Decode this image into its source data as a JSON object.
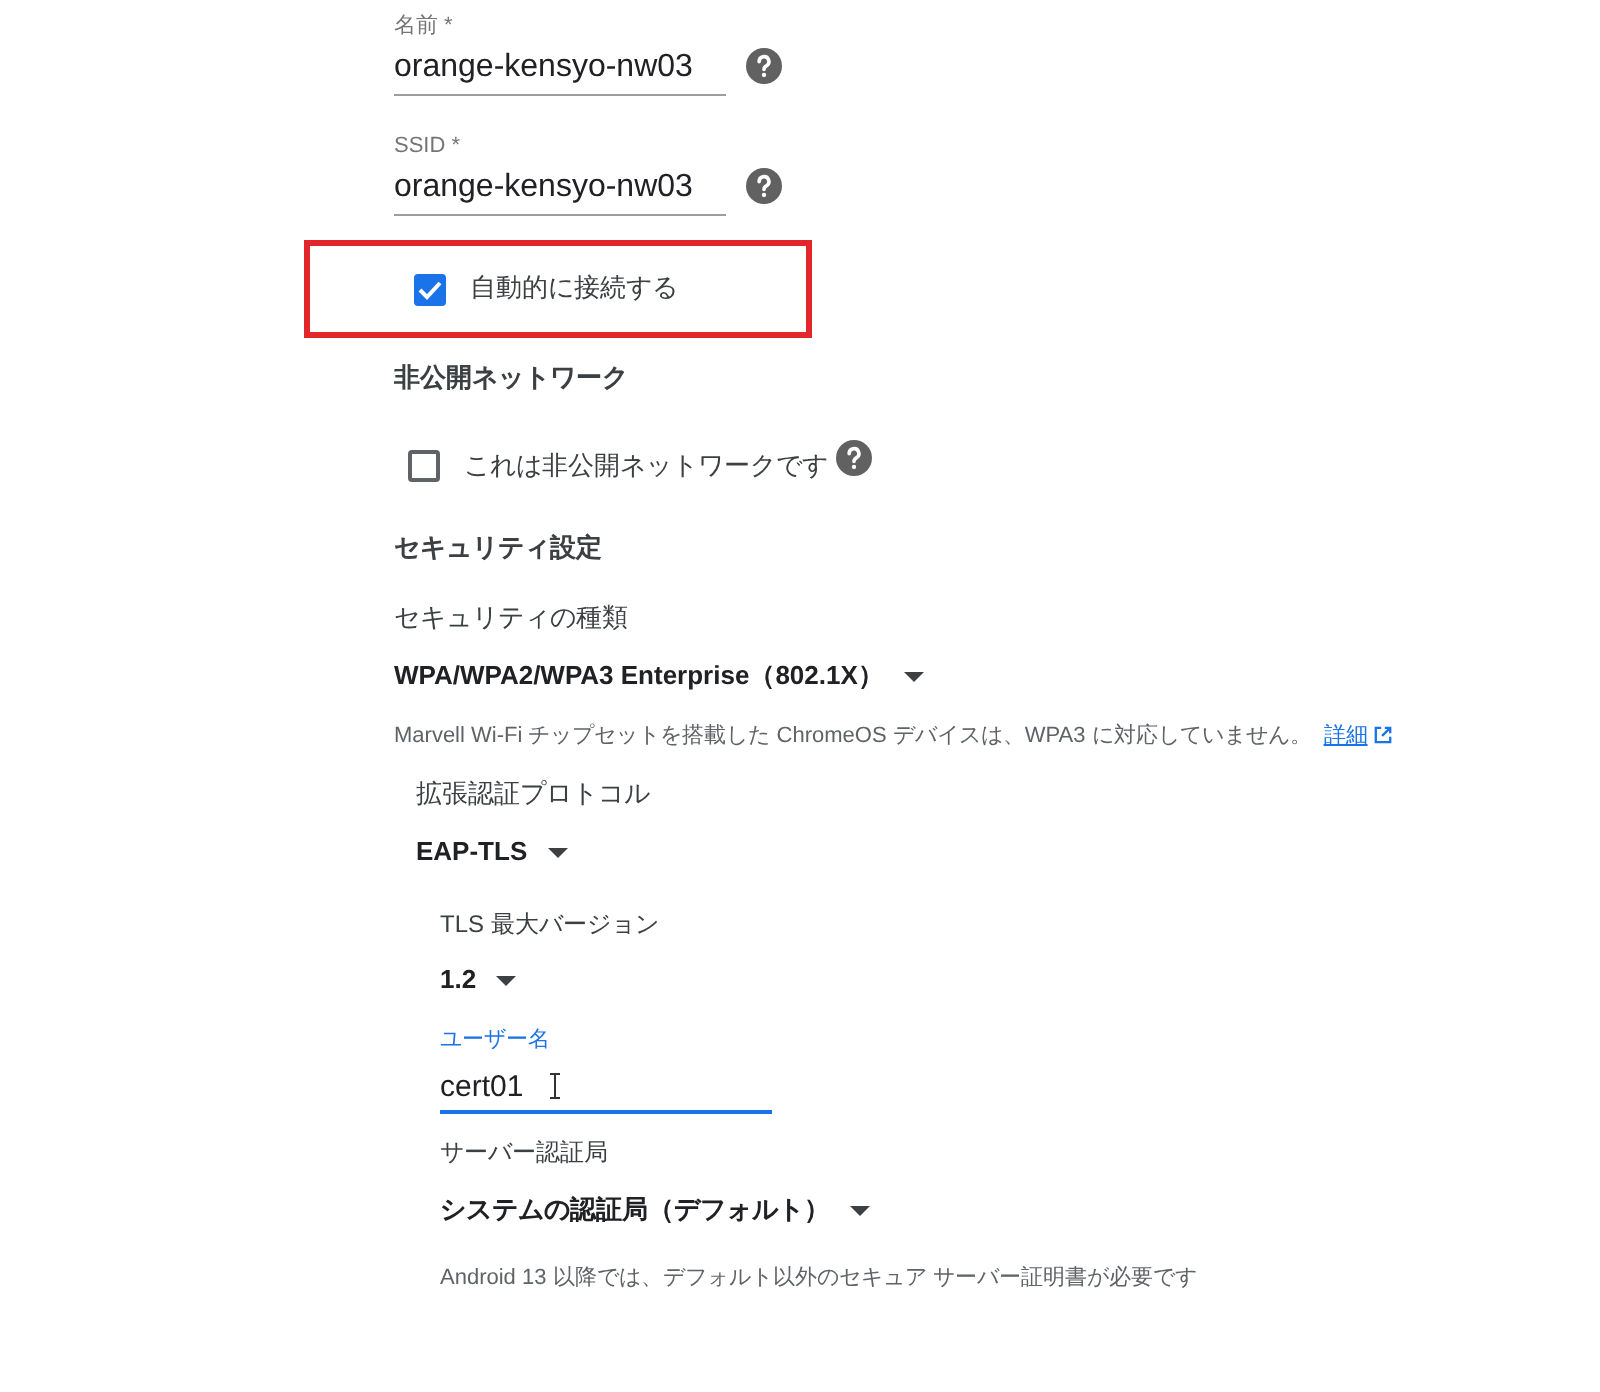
{
  "name_field": {
    "label": "名前 *",
    "value": "orange-kensyo-nw03"
  },
  "ssid_field": {
    "label": "SSID *",
    "value": "orange-kensyo-nw03"
  },
  "auto_connect": {
    "label": "自動的に接続する",
    "checked": true,
    "highlighted": true
  },
  "hidden_network": {
    "heading": "非公開ネットワーク",
    "label": "これは非公開ネットワークです",
    "checked": false
  },
  "security": {
    "heading": "セキュリティ設定",
    "type_label": "セキュリティの種類",
    "type_value": "WPA/WPA2/WPA3 Enterprise（802.1X）",
    "note": "Marvell Wi-Fi チップセットを搭載した ChromeOS デバイスは、WPA3 に対応していません。",
    "note_link": "詳細",
    "eap_label": "拡張認証プロトコル",
    "eap_value": "EAP-TLS",
    "tls_label": "TLS 最大バージョン",
    "tls_value": "1.2",
    "username": {
      "label": "ユーザー名",
      "value": "cert01",
      "focused": true
    },
    "ca_label": "サーバー認証局",
    "ca_value": "システムの認証局（デフォルト）",
    "ca_note": "Android 13 以降では、デフォルト以外のセキュア サーバー証明書が必要です"
  }
}
